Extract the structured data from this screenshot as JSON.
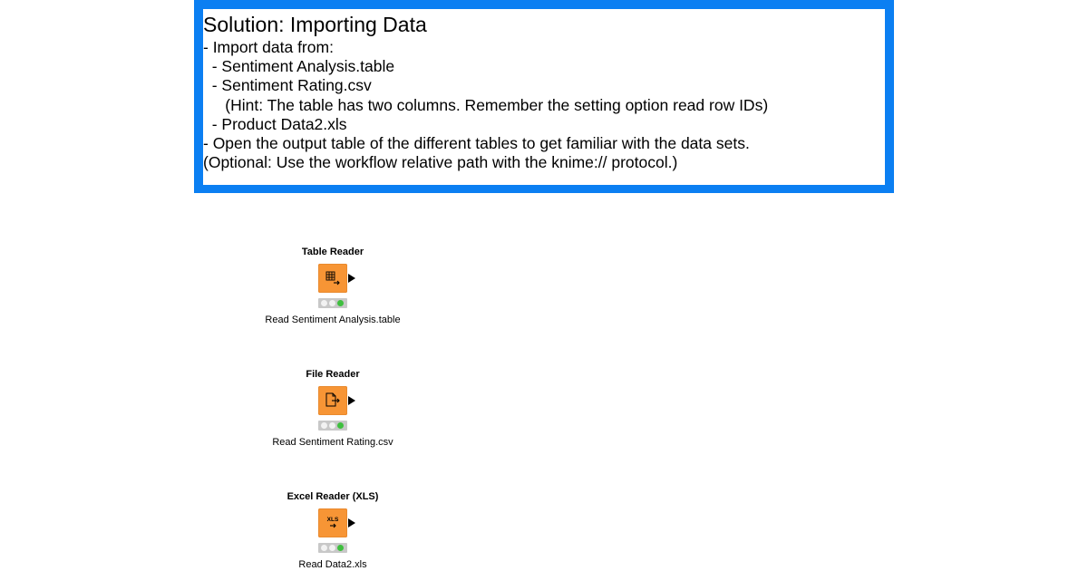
{
  "annotation": {
    "title": "Solution: Importing Data",
    "lines": [
      "- Import data from:",
      "  - Sentiment Analysis.table",
      "  - Sentiment Rating.csv",
      "     (Hint: The table has two columns. Remember the setting option read row IDs)",
      "  - Product Data2.xls",
      "- Open the output table of the different tables to get familiar with the data sets.",
      "(Optional: Use the workflow relative path with the knime:// protocol.)"
    ],
    "border_color": "#0b7ff2"
  },
  "nodes": [
    {
      "type": "Table Reader",
      "label": "Read Sentiment Analysis.table",
      "icon": "table-reader-icon",
      "status": "executed",
      "color": "#f79535"
    },
    {
      "type": "File Reader",
      "label": "Read Sentiment Rating.csv",
      "icon": "file-reader-icon",
      "status": "executed",
      "color": "#f79535"
    },
    {
      "type": "Excel Reader (XLS)",
      "label": "Read Data2.xls",
      "icon": "excel-reader-icon",
      "icon_text": "XLS",
      "status": "executed",
      "color": "#f79535"
    }
  ]
}
